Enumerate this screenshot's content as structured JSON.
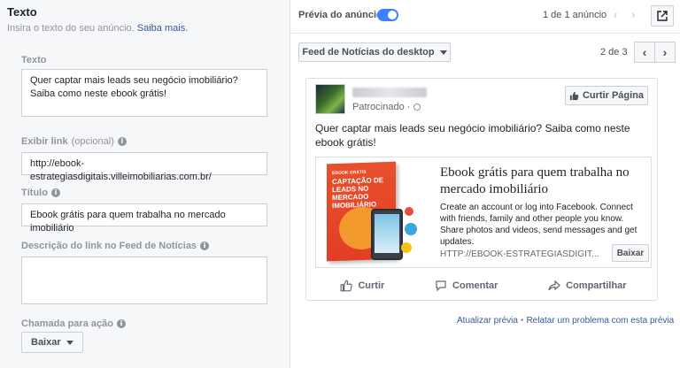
{
  "left": {
    "section_title": "Texto",
    "section_subtitle": "Insira o texto do seu anúncio.",
    "learn_more": "Saiba mais.",
    "text_label": "Texto",
    "text_value_line1": "Quer captar mais leads seu negócio imobiliário?",
    "text_value_line2": "Saiba como neste ebook grátis!",
    "display_link_label": "Exibir link",
    "display_link_optional": "(opcional)",
    "display_link_value": "http://ebook-estrategiasdigitais.villeimobiliarias.com.br/",
    "title_label": "Título",
    "title_value": "Ebook grátis para quem trabalha no mercado imobiliário",
    "desc_label": "Descrição do link no Feed de Notícias",
    "desc_value": "",
    "cta_label": "Chamada para ação",
    "cta_value": "Baixar"
  },
  "preview": {
    "toggle_label": "Prévia do anúncio",
    "toggle_on": true,
    "ad_count": "1 de 1 anúncio",
    "placement": "Feed de Notícias do desktop",
    "page_count": "2 de 3"
  },
  "ad": {
    "sponsored": "Patrocinado ·",
    "like_page": "Curtir Página",
    "body": "Quer captar mais leads seu negócio imobiliário? Saiba como neste ebook grátis!",
    "ebook_small": "EBOOK GRÁTIS",
    "ebook_title": "CAPTAÇÃO DE LEADS NO MERCADO IMOBILIÁRIO",
    "link_title": "Ebook grátis para quem trabalha no mercado imobiliário",
    "link_desc": "Create an account or log into Facebook. Connect with friends, family and other people you know. Share photos and videos, send messages and get updates.",
    "link_url": "HTTP://EBOOK-ESTRATEGIASDIGIT...",
    "cta_button": "Baixar",
    "like": "Curtir",
    "comment": "Comentar",
    "share": "Compartilhar"
  },
  "footer": {
    "update_preview": "Atualizar prévia",
    "separator": "•",
    "report_problem": "Relatar um problema com esta prévia"
  },
  "colors": {
    "accent": "#4080ff",
    "link": "#365899",
    "ebook_red": "#e23e26"
  }
}
